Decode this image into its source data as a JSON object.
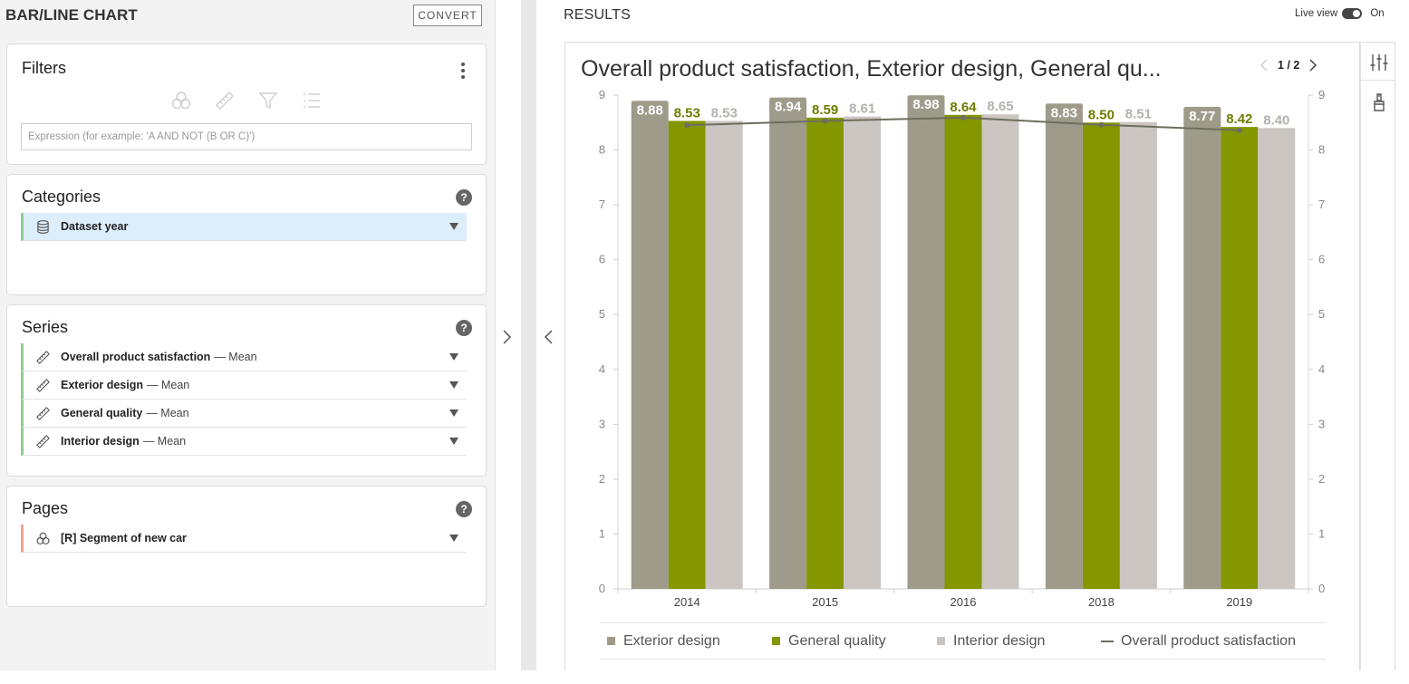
{
  "left_panel": {
    "title": "BAR/LINE CHART",
    "convert_label": "CONVERT",
    "filters": {
      "title": "Filters",
      "expression_placeholder": "Expression (for example: 'A AND NOT (B OR C)')",
      "expression_value": ""
    },
    "categories": {
      "title": "Categories",
      "help": "?",
      "items": [
        {
          "label": "Dataset year",
          "icon": "database-icon"
        }
      ]
    },
    "series": {
      "title": "Series",
      "help": "?",
      "items": [
        {
          "label": "Overall product satisfaction",
          "suffix": "— Mean",
          "icon": "ruler-icon"
        },
        {
          "label": "Exterior design",
          "suffix": "— Mean",
          "icon": "ruler-icon"
        },
        {
          "label": "General quality",
          "suffix": "— Mean",
          "icon": "ruler-icon"
        },
        {
          "label": "Interior design",
          "suffix": "— Mean",
          "icon": "ruler-icon"
        }
      ]
    },
    "pages": {
      "title": "Pages",
      "help": "?",
      "items": [
        {
          "label": "[R] Segment of new car",
          "icon": "segment-icon"
        }
      ]
    }
  },
  "results": {
    "title": "RESULTS",
    "live_view_label": "Live view",
    "live_view_state": "On",
    "pager": {
      "current": "1",
      "sep": "/",
      "total": "2"
    }
  },
  "chart_data": {
    "type": "bar",
    "title": "Overall product satisfaction, Exterior design, General qu...",
    "categories": [
      "2014",
      "2015",
      "2016",
      "2018",
      "2019"
    ],
    "series": [
      {
        "name": "Exterior design",
        "values": [
          8.88,
          8.94,
          8.98,
          8.83,
          8.77
        ],
        "color": "#9e9b8a",
        "label_color": "#ffffff",
        "label_bg": "#9e9b8a"
      },
      {
        "name": "General quality",
        "values": [
          8.53,
          8.59,
          8.64,
          8.5,
          8.42
        ],
        "color": "#849600",
        "label_color": "#6e7d00",
        "label_bg": null
      },
      {
        "name": "Interior design",
        "values": [
          8.53,
          8.61,
          8.65,
          8.51,
          8.4
        ],
        "color": "#cbc6c2",
        "label_color": "#b5b1ad",
        "label_bg": null
      }
    ],
    "line_series": {
      "name": "Overall product satisfaction",
      "values": [
        8.45,
        8.53,
        8.59,
        8.46,
        8.36
      ],
      "color": "#6e6e5e"
    },
    "ylim": [
      0,
      9
    ],
    "yticks": [
      "0",
      "1",
      "2",
      "3",
      "4",
      "5",
      "6",
      "7",
      "8",
      "9"
    ],
    "xlabel": "",
    "ylabel": "",
    "grid": false,
    "legend_position": "bottom"
  }
}
